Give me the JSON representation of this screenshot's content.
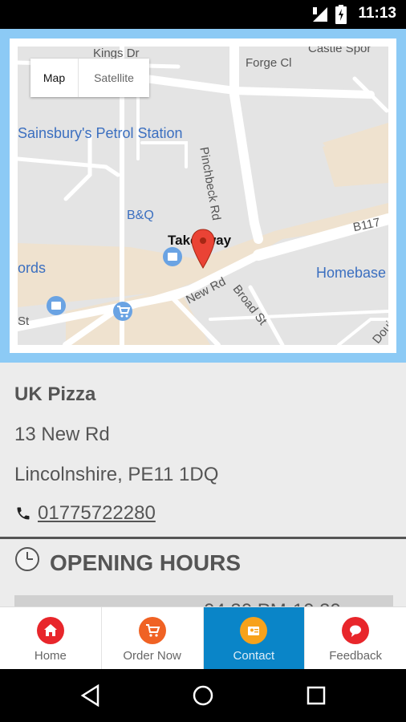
{
  "status_bar": {
    "time": "11:13"
  },
  "map": {
    "toggle": {
      "map_label": "Map",
      "satellite_label": "Satellite"
    },
    "labels": {
      "kings": "Kings Dr",
      "castle": "Castle Spor",
      "forge": "Forge Cl",
      "petrol": "Sainsbury's Petrol Station",
      "pinchbeck": "Pinchbeck Rd",
      "bq": "B&Q",
      "b117": "B117",
      "takeaway": "Takeaway",
      "ords": "ords",
      "homebase": "Homebase",
      "new_rd": "New Rd",
      "broad_st": "Broad St",
      "st": "St",
      "doui": "Doui"
    }
  },
  "restaurant": {
    "name": "UK Pizza",
    "address_line1": "13 New Rd",
    "address_line2": "Lincolnshire, PE11 1DQ",
    "phone": "01775722280"
  },
  "opening_hours": {
    "title": "OPENING HOURS",
    "first_row_partial": "04:30 PM-10:30"
  },
  "tabs": [
    {
      "label": "Home",
      "icon": "home-icon",
      "color": "#e8262b"
    },
    {
      "label": "Order Now",
      "icon": "cart-icon",
      "color": "#f06224"
    },
    {
      "label": "Contact",
      "icon": "contact-icon",
      "color": "#f7a21b",
      "active": true
    },
    {
      "label": "Feedback",
      "icon": "chat-icon",
      "color": "#e8262b"
    }
  ],
  "colors": {
    "accent": "#0a85c8",
    "map_border": "#8ccaf5"
  }
}
